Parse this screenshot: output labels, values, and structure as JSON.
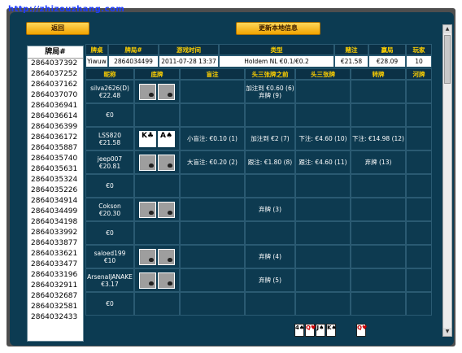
{
  "watermark": "http://zhizouzhang.com",
  "buttons": {
    "back": "返回",
    "update": "更新本地信息"
  },
  "left_list": {
    "header": "牌局#",
    "items": [
      "2864037392",
      "2864037252",
      "2864037162",
      "2864037070",
      "2864036941",
      "2864036614",
      "2864036399",
      "2864036172",
      "2864035887",
      "2864035740",
      "2864035631",
      "2864035324",
      "2864035226",
      "2864034914",
      "2864034499",
      "2864034198",
      "2864033992",
      "2864033877",
      "2864033621",
      "2864033477",
      "2864033196",
      "2864032911",
      "2864032687",
      "2864032581",
      "2864032433"
    ]
  },
  "table": {
    "info_headers": [
      "牌桌",
      "牌局#",
      "游戏时间",
      "类型",
      "赌注",
      "赢局",
      "玩家"
    ],
    "info_row": [
      "Yiwuw",
      "2864034499",
      "2011-07-28 13:37",
      "Holdem NL €0.1/€0.2",
      "€21.58",
      "€28.09",
      "10"
    ],
    "player_headers": [
      "昵称",
      "底牌",
      "盲注",
      "头三张牌之前",
      "头三张牌",
      "转牌",
      "河牌"
    ],
    "rows": [
      {
        "name": "silva2626(D)\n€22.48",
        "cards": "back",
        "blind": "",
        "preflop": "加注到 €0.60 (6)\n弃牌 (9)",
        "flop": "",
        "turn": "",
        "river": ""
      },
      {
        "name": "€0",
        "cards": "none",
        "blind": "",
        "preflop": "",
        "flop": "",
        "turn": "",
        "river": ""
      },
      {
        "name": "LSS820\n€21.58",
        "cards": "face",
        "card_labels": [
          "K♣",
          "A♠"
        ],
        "blind": "小盲注: €0.10 (1)",
        "preflop": "加注到 €2 (7)",
        "flop": "下注: €4.60 (10)",
        "turn": "下注: €14.98 (12)",
        "river": ""
      },
      {
        "name": "jeep007\n€20.81",
        "cards": "back",
        "blind": "大盲注: €0.20 (2)",
        "preflop": "跟注: €1.80 (8)",
        "flop": "跟注: €4.60 (11)",
        "turn": "弃牌 (13)",
        "river": ""
      },
      {
        "name": "€0",
        "cards": "none",
        "blind": "",
        "preflop": "",
        "flop": "",
        "turn": "",
        "river": ""
      },
      {
        "name": "Cokson\n€20.30",
        "cards": "back",
        "blind": "",
        "preflop": "弃牌 (3)",
        "flop": "",
        "turn": "",
        "river": ""
      },
      {
        "name": "€0",
        "cards": "none",
        "blind": "",
        "preflop": "",
        "flop": "",
        "turn": "",
        "river": ""
      },
      {
        "name": "saloed199\n€10",
        "cards": "back",
        "blind": "",
        "preflop": "弃牌 (4)",
        "flop": "",
        "turn": "",
        "river": ""
      },
      {
        "name": "ArsenalJANAKE\n€3.17",
        "cards": "back",
        "blind": "",
        "preflop": "弃牌 (5)",
        "flop": "",
        "turn": "",
        "river": ""
      },
      {
        "name": "€0",
        "cards": "none",
        "blind": "",
        "preflop": "",
        "flop": "",
        "turn": "",
        "river": ""
      }
    ],
    "board_flop": [
      "4♠",
      "Q♥",
      "J♠",
      "K♠"
    ],
    "board_turn": [
      "Q♥"
    ]
  },
  "colors": {
    "window_bg": "#0c3b52",
    "header_text": "#ffd000",
    "button": "#f0a400"
  }
}
